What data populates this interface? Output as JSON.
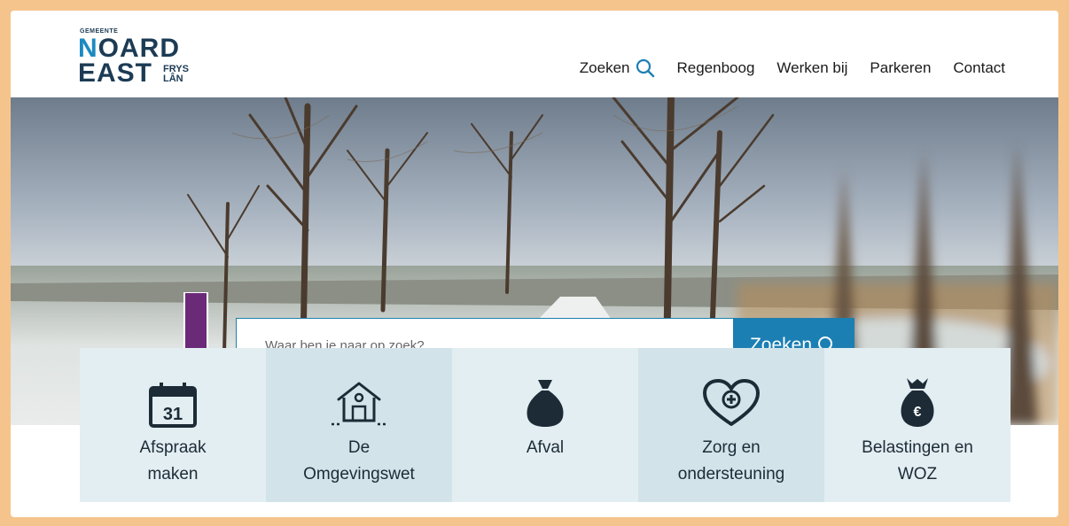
{
  "logo": {
    "prefix": "GEMEENTE",
    "line1": "NOARD",
    "line2": "EAST",
    "suffix1": "FRYS",
    "suffix2": "LÂN"
  },
  "nav": [
    {
      "label": "Zoeken",
      "icon": "search-icon"
    },
    {
      "label": "Regenboog"
    },
    {
      "label": "Werken bij"
    },
    {
      "label": "Parkeren"
    },
    {
      "label": "Contact"
    }
  ],
  "search": {
    "placeholder": "Waar ben je naar op zoek?",
    "button_label": "Zoeken"
  },
  "annotation": {
    "arrow_color": "#6b2a78"
  },
  "colors": {
    "accent": "#1c7fb3",
    "tile_light": "#e3eef2",
    "tile_dark": "#d3e3ea",
    "icon": "#1c2b36",
    "frame": "#f5c48c"
  },
  "tiles": [
    {
      "label": "Afspraak maken",
      "icon": "calendar-icon",
      "icon_text": "31"
    },
    {
      "label": "De Omgevingswet",
      "icon": "house-icon"
    },
    {
      "label": "Afval",
      "icon": "garbage-bag-icon"
    },
    {
      "label": "Zorg en ondersteuning",
      "icon": "heart-plus-icon"
    },
    {
      "label": "Belastingen en WOZ",
      "icon": "money-bag-icon",
      "icon_text": "€"
    }
  ]
}
